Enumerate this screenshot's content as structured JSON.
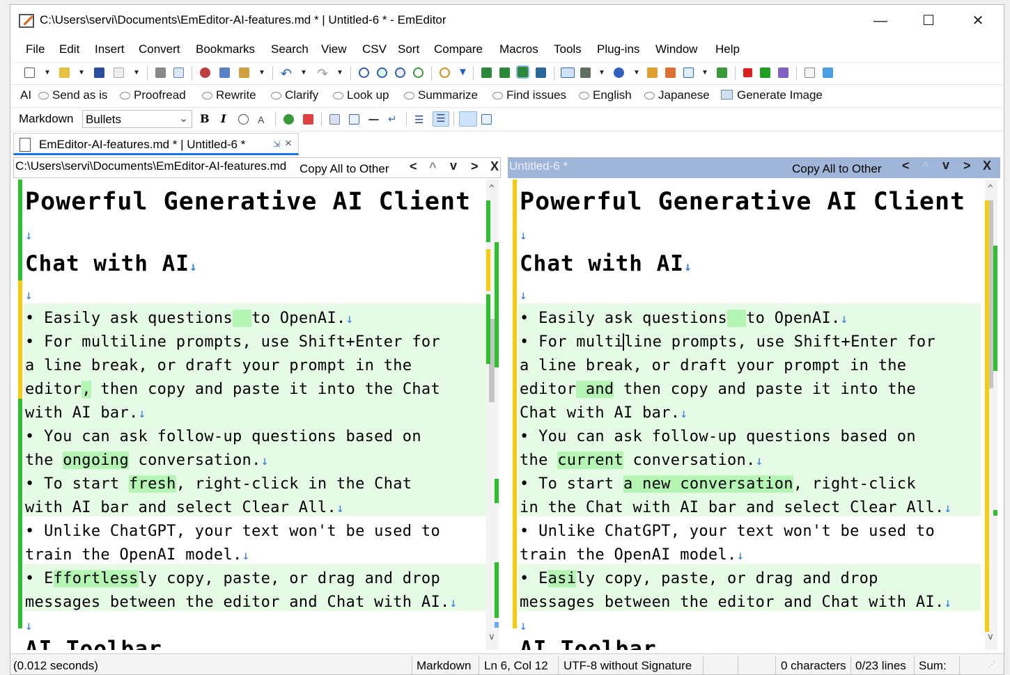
{
  "window": {
    "title": "C:\\Users\\servi\\Documents\\EmEditor-AI-features.md * | Untitled-6 * - EmEditor",
    "minimize": "—",
    "maximize": "☐",
    "close": "✕"
  },
  "menu": [
    "File",
    "Edit",
    "Insert",
    "Convert",
    "Bookmarks",
    "Search",
    "View",
    "CSV",
    "Sort",
    "Compare",
    "Macros",
    "Tools",
    "Plug-ins",
    "Window",
    "Help"
  ],
  "ai_toolbar": {
    "label": "AI",
    "buttons": [
      "Send as is",
      "Proofread",
      "Rewrite",
      "Clarify",
      "Look up",
      "Summarize",
      "Find issues",
      "English",
      "Japanese"
    ],
    "generate_image": "Generate Image"
  },
  "markdown_toolbar": {
    "label": "Markdown",
    "select_value": "Bullets",
    "bold": "B",
    "italic": "I"
  },
  "tab": {
    "label": "EmEditor-AI-features.md * | Untitled-6 *",
    "close": "×"
  },
  "left_pane": {
    "path": "C:\\Users\\servi\\Documents\\EmEditor-AI-features.md",
    "copy_all": "Copy All to Other"
  },
  "right_pane": {
    "path": "Untitled-6 *",
    "copy_all": "Copy All to Other"
  },
  "nav": {
    "prev_diff": "<",
    "up": "^",
    "down": "v",
    "next_diff": ">",
    "close": "X"
  },
  "status": {
    "time": "(0.012 seconds)",
    "mode": "Markdown",
    "position": "Ln 6, Col 12",
    "encoding": "UTF-8 without Signature",
    "chars": "0 characters",
    "lines": "0/23 lines",
    "sum": "Sum:"
  },
  "colors": {
    "accent": "#1a73e8",
    "diff_highlight": "#b4f5b4",
    "diff_background": "#e6fbe6",
    "marker_green": "#2ec02e",
    "marker_yellow": "#f5cc10",
    "right_header": "#9fb6d8"
  }
}
